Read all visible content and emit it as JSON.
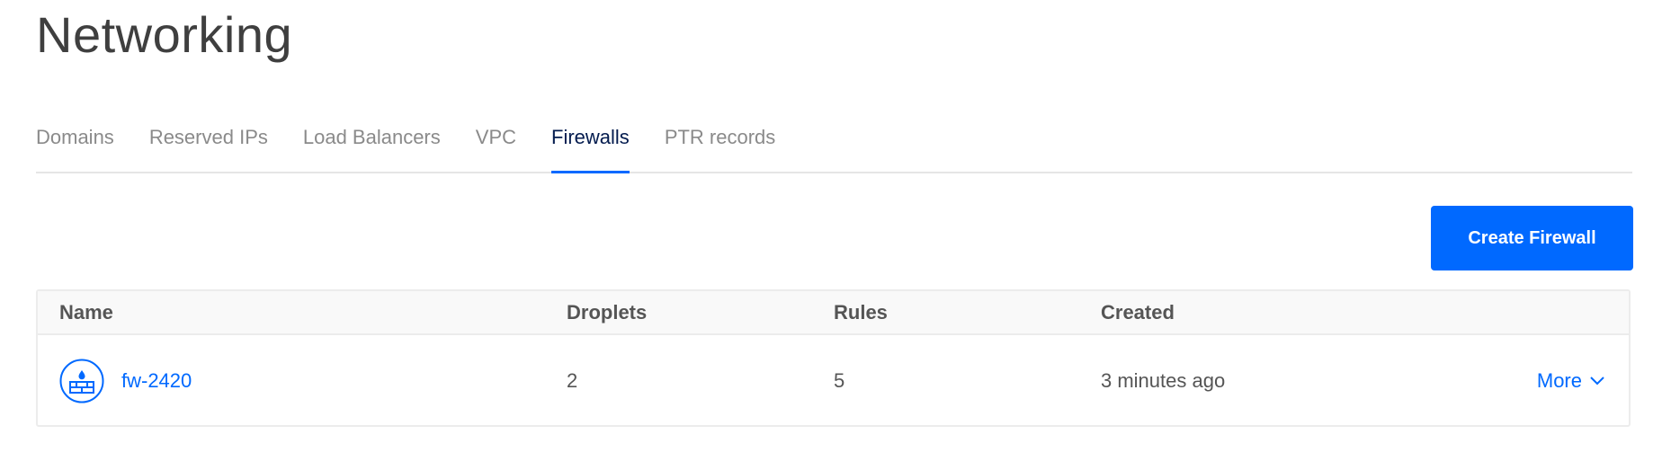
{
  "page": {
    "title": "Networking"
  },
  "tabs": [
    {
      "label": "Domains",
      "active": false
    },
    {
      "label": "Reserved IPs",
      "active": false
    },
    {
      "label": "Load Balancers",
      "active": false
    },
    {
      "label": "VPC",
      "active": false
    },
    {
      "label": "Firewalls",
      "active": true
    },
    {
      "label": "PTR records",
      "active": false
    }
  ],
  "actions": {
    "create_label": "Create Firewall"
  },
  "table": {
    "headers": {
      "name": "Name",
      "droplets": "Droplets",
      "rules": "Rules",
      "created": "Created"
    },
    "rows": [
      {
        "icon": "firewall-icon",
        "name": "fw-2420",
        "droplets": "2",
        "rules": "5",
        "created": "3 minutes ago",
        "more_label": "More",
        "more_icon": "chevron-down-icon"
      }
    ]
  },
  "colors": {
    "accent": "#0069ff",
    "active_tab_text": "#031b4e",
    "inactive_tab_text": "#8a8a8a"
  }
}
